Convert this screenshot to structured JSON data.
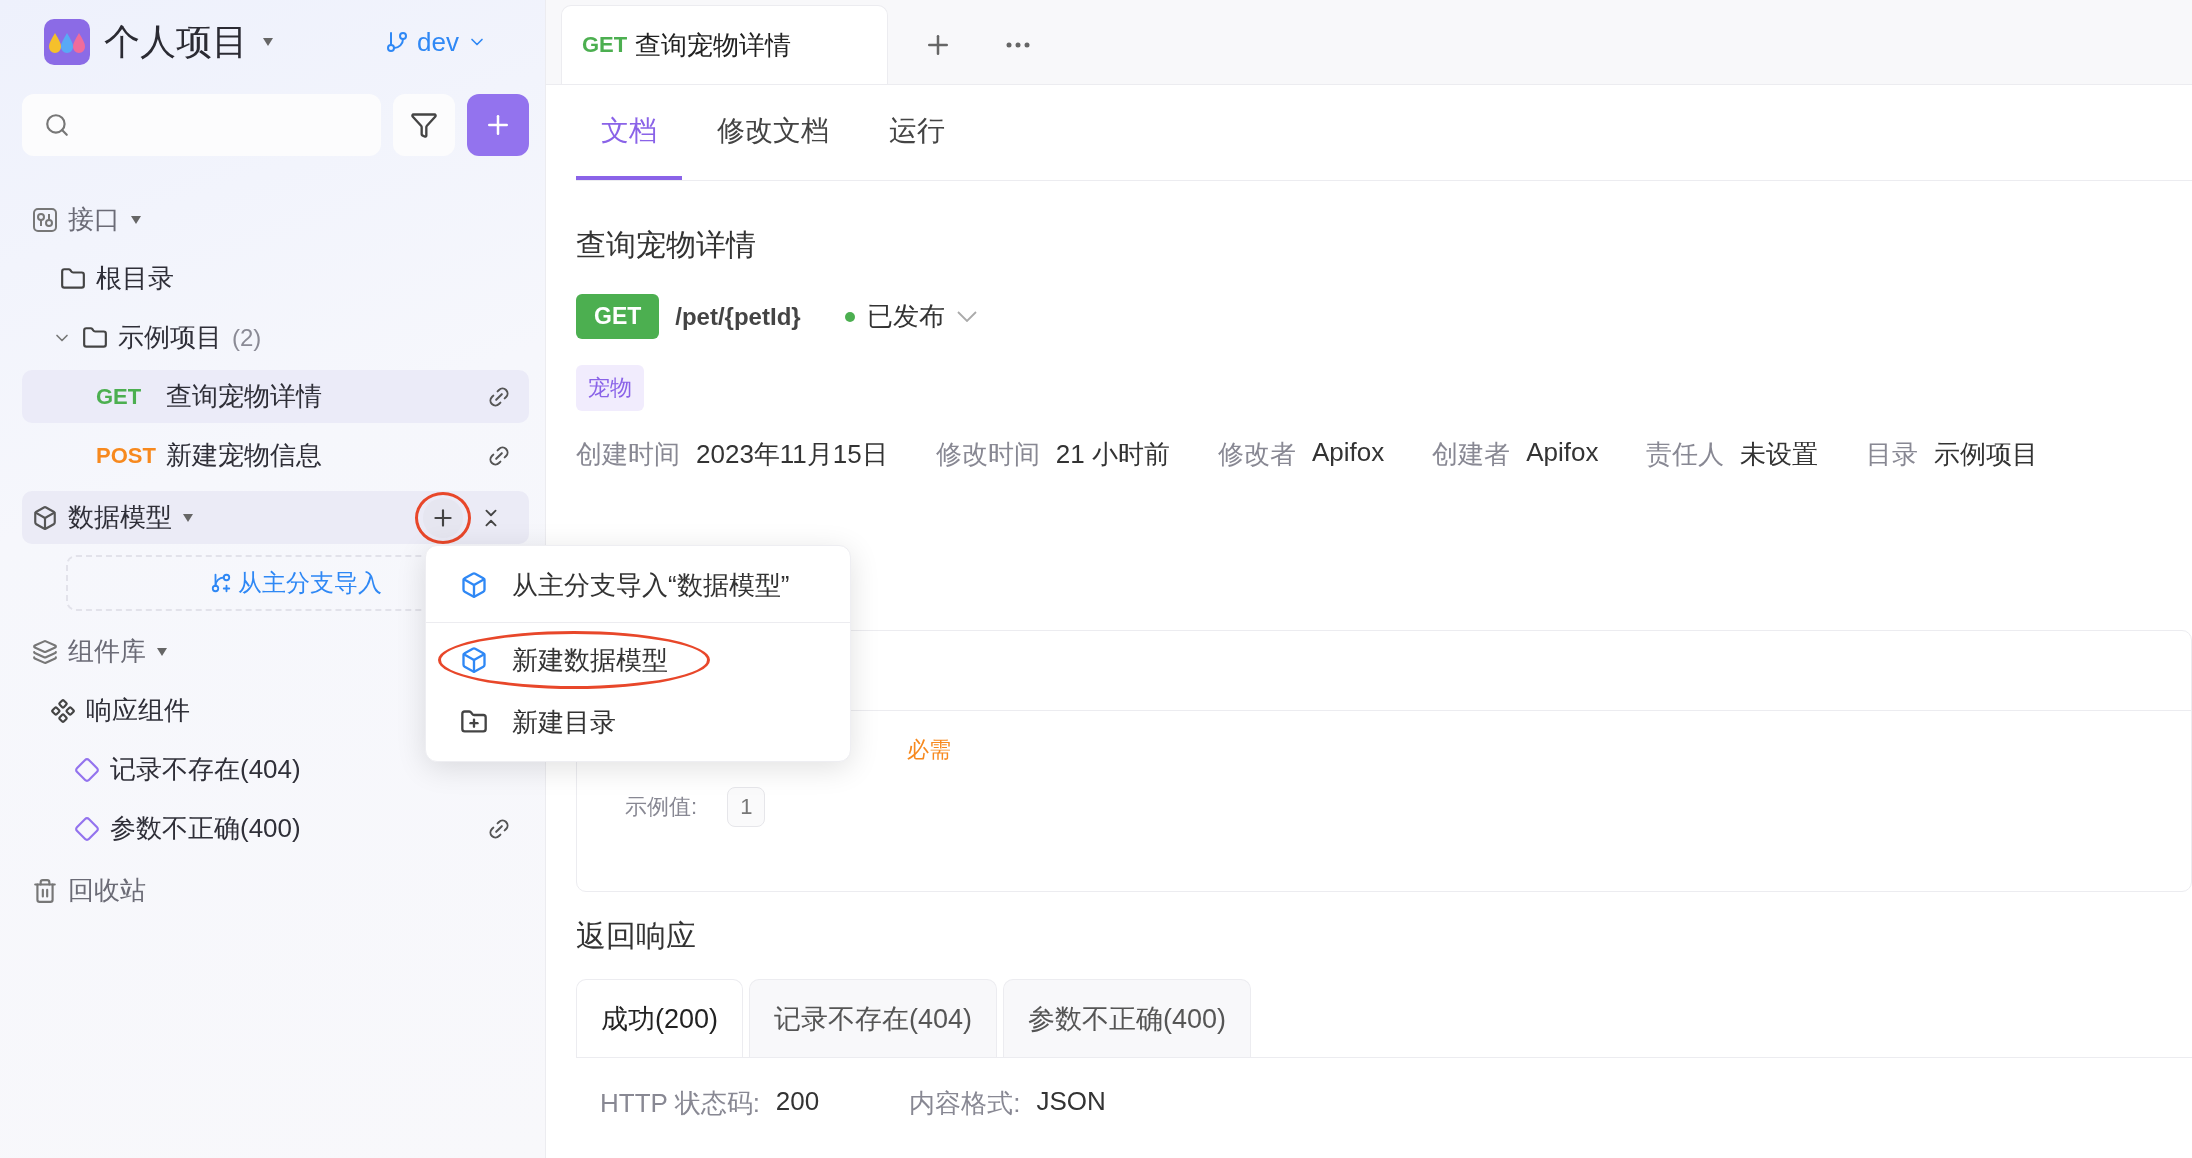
{
  "project": {
    "title": "个人项目",
    "branch": "dev"
  },
  "sections": [
    {
      "kind": "api",
      "label": "接口",
      "active": false,
      "children": [
        {
          "kind": "folder",
          "label": "根目录"
        },
        {
          "kind": "folder",
          "label": "示例项目",
          "count": "(2)",
          "expanded": true,
          "children": [
            {
              "kind": "endpoint",
              "method": "GET",
              "color": "#4caf50",
              "label": "查询宠物详情",
              "selected": true,
              "link": true
            },
            {
              "kind": "endpoint",
              "method": "POST",
              "color": "#f7891e",
              "label": "新建宠物信息",
              "selected": false,
              "link": true
            }
          ]
        }
      ]
    },
    {
      "kind": "models",
      "label": "数据模型",
      "active": true,
      "circled": true,
      "import_label": "从主分支导入"
    },
    {
      "kind": "components",
      "label": "组件库",
      "active": false,
      "children": [
        {
          "kind": "group",
          "label": "响应组件",
          "children": [
            {
              "kind": "component",
              "label": "记录不存在(404)",
              "link": false
            },
            {
              "kind": "component",
              "label": "参数不正确(400)",
              "link": true
            }
          ]
        }
      ]
    },
    {
      "kind": "trash",
      "label": "回收站",
      "active": false
    }
  ],
  "tabs": [
    {
      "method": "GET",
      "title": "查询宠物详情",
      "selected": true
    }
  ],
  "doc_tabs": [
    {
      "label": "文档",
      "selected": true
    },
    {
      "label": "修改文档",
      "selected": false
    },
    {
      "label": "运行",
      "selected": false
    }
  ],
  "doc": {
    "title": "查询宠物详情",
    "method": "GET",
    "path": "/pet/{petId}",
    "status": "已发布",
    "tag": "宠物",
    "meta": [
      {
        "label": "创建时间",
        "value": "2023年11月15日"
      },
      {
        "label": "修改时间",
        "value": "21 小时前"
      },
      {
        "label": "修改者",
        "value": "Apifox"
      },
      {
        "label": "创建者",
        "value": "Apifox"
      },
      {
        "label": "责任人",
        "value": "未设置"
      },
      {
        "label": "目录",
        "value": "示例项目"
      }
    ]
  },
  "params": {
    "required": "必需",
    "example_label": "示例值:",
    "example": "1"
  },
  "responses": {
    "title": "返回响应",
    "tabs": [
      {
        "label": "成功(200)",
        "selected": true
      },
      {
        "label": "记录不存在(404)",
        "selected": false
      },
      {
        "label": "参数不正确(400)",
        "selected": false
      }
    ],
    "status_label": "HTTP 状态码:",
    "status": "200",
    "format_label": "内容格式:",
    "format": "JSON"
  },
  "menu": {
    "items": [
      {
        "kind": "cube",
        "label": "从主分支导入“数据模型”",
        "circled": false,
        "divider_after": true
      },
      {
        "kind": "cube",
        "label": "新建数据模型",
        "circled": true,
        "divider_after": false
      },
      {
        "kind": "folder",
        "label": "新建目录",
        "circled": false,
        "divider_after": false
      }
    ]
  }
}
